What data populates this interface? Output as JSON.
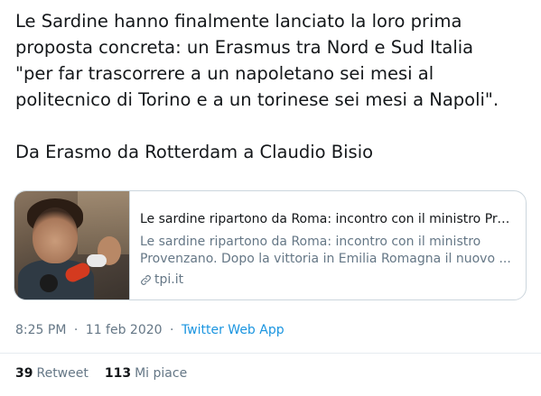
{
  "tweet": {
    "text": "Le Sardine hanno finalmente lanciato la loro prima\nproposta concreta: un Erasmus tra Nord e Sud Italia\n\"per far trascorrere a un napoletano sei mesi al\npolitecnico di Torino e a un torinese sei mesi a Napoli\".\n\nDa Erasmo da Rotterdam a Claudio Bisio"
  },
  "card": {
    "title": "Le sardine ripartono da Roma: incontro con il ministro Proven...",
    "description": "Le sardine ripartono da Roma: incontro con il ministro Provenzano. Dopo la vittoria in Emilia Romagna il nuovo ...",
    "domain": "tpi.it",
    "image_alt": "photo"
  },
  "meta": {
    "time": "8:25 PM",
    "separator_1": "·",
    "date": "11 feb 2020",
    "separator_2": "·",
    "source": "Twitter Web App"
  },
  "stats": {
    "retweets_count": "39",
    "retweets_label": "Retweet",
    "likes_count": "113",
    "likes_label": "Mi piace"
  },
  "colors": {
    "text": "#14171a",
    "secondary": "#657786",
    "link": "#1b95e0",
    "border": "#ccd6dd"
  },
  "icons": {
    "link": "link-icon"
  }
}
